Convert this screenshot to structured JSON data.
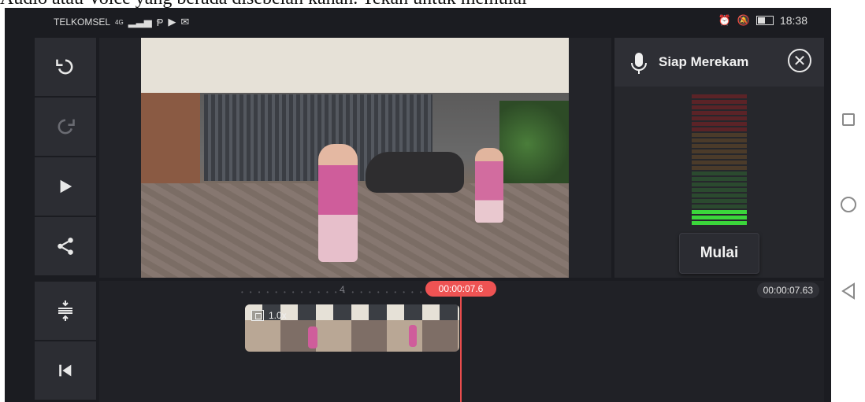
{
  "caption": "Audio atau Voice yang berada disebelah kanan. Tekan untuk memulai",
  "statusbar": {
    "carrier": "TELKOMSEL",
    "network": "4G",
    "time": "18:38"
  },
  "toolbar": {
    "undo_icon": "undo-icon",
    "redo_icon": "redo-icon",
    "play_icon": "play-icon",
    "share_icon": "share-icon",
    "split_icon": "split-icon",
    "skip_start_icon": "skip-to-start-icon"
  },
  "recorder": {
    "title": "Siap Merekam",
    "start_label": "Mulai",
    "level": 0.12
  },
  "timeline": {
    "tick_label": "4",
    "clip_speed": "1.0x",
    "playhead_time": "00:00:07.6",
    "total_duration": "00:00:07.63"
  },
  "colors": {
    "accent": "#ee5353",
    "meter_active": "#3bd63b",
    "panel": "#2c2d33"
  }
}
